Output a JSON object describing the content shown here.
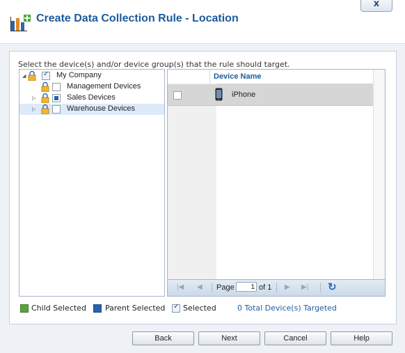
{
  "dialog": {
    "title": "Create Data Collection Rule - Location",
    "close_label": "x"
  },
  "instruction": "Select the device(s) and/or device group(s) that the rule should target.",
  "tree": {
    "items": [
      {
        "label": "My Company",
        "state": "checked",
        "expander": "collapse"
      },
      {
        "label": "Management Devices",
        "state": "unchecked",
        "expander": "none"
      },
      {
        "label": "Sales Devices",
        "state": "partial",
        "expander": "expand"
      },
      {
        "label": "Warehouse Devices",
        "state": "unchecked",
        "expander": "expand",
        "selected": true
      }
    ]
  },
  "grid": {
    "column_header": "Device Name",
    "rows": [
      {
        "name": "iPhone",
        "icon": "phone-icon",
        "checked": false
      }
    ],
    "pager": {
      "page_label": "Page",
      "page_value": "1",
      "of_label": "of 1"
    }
  },
  "legend": {
    "child_selected": "Child Selected",
    "parent_selected": "Parent Selected",
    "selected": "Selected",
    "total_targeted": "0 Total Device(s) Targeted"
  },
  "buttons": {
    "back": "Back",
    "next": "Next",
    "cancel": "Cancel",
    "help": "Help"
  },
  "colors": {
    "accent": "#1e5a9c",
    "child_selected": "#56a43d",
    "parent_selected": "#2563b2",
    "row_highlight": "#d6d6d6"
  }
}
